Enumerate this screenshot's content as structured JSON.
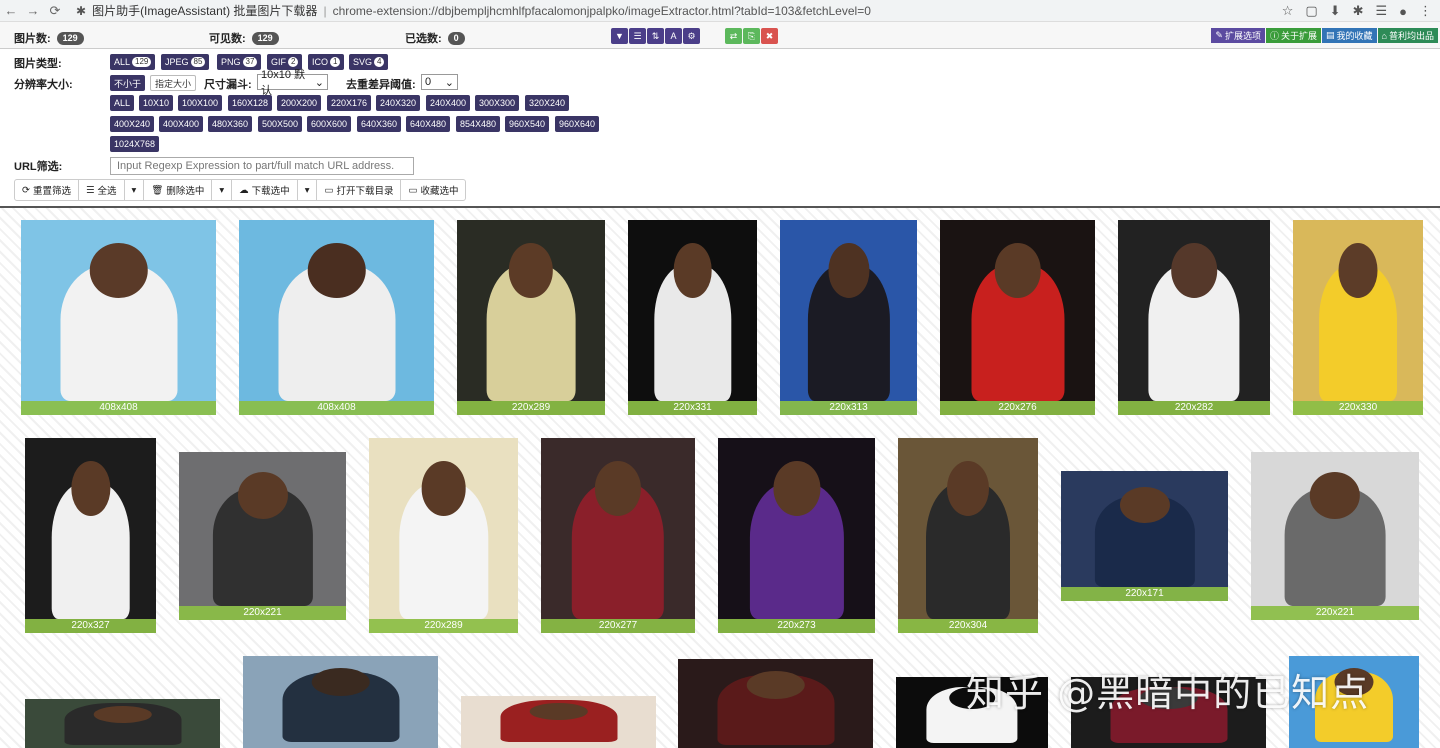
{
  "browser": {
    "back_icon": "←",
    "forward_icon": "→",
    "reload_icon": "⟳",
    "ext_icon": "✱",
    "tab_title": "图片助手(ImageAssistant) 批量图片下载器",
    "separator": "|",
    "url": "chrome-extension://dbjbempljhcmhlfpfacalomonjpalpko/imageExtractor.html?tabId=103&fetchLevel=0",
    "right_icons": [
      "☆",
      "▢",
      "⬇",
      "✱",
      "☰",
      "●",
      "⋮"
    ]
  },
  "stats": {
    "total_label": "图片数:",
    "total_value": "129",
    "visible_label": "可见数:",
    "visible_value": "129",
    "selected_label": "已选数:",
    "selected_value": "0"
  },
  "toolbar_icons": {
    "filter": "▼",
    "list": "☰",
    "sort": "⇅",
    "font": "A",
    "settings": "⚙",
    "swap": "⇄",
    "copy": "⎘",
    "close": "✖"
  },
  "ext_links": {
    "options": "扩展选项",
    "about": "关于扩展",
    "favorites": "我的收藏",
    "home": "普利均出品"
  },
  "filters": {
    "type_label": "图片类型:",
    "types": [
      {
        "name": "ALL",
        "count": "129"
      },
      {
        "name": "JPEG",
        "count": "85"
      },
      {
        "name": "PNG",
        "count": "37"
      },
      {
        "name": "GIF",
        "count": "2"
      },
      {
        "name": "ICO",
        "count": "1"
      },
      {
        "name": "SVG",
        "count": "4"
      }
    ],
    "resolution_label": "分辨率大小:",
    "not_less": "不小于",
    "specify": "指定大小",
    "funnel_label": "尺寸漏斗:",
    "funnel_value": "10x10 默认",
    "dedupe_label": "去重差异阈值:",
    "dedupe_value": "0",
    "sizes_row1": [
      "ALL",
      "10X10",
      "100X100",
      "160X128",
      "200X200",
      "220X176",
      "240X320",
      "240X400",
      "300X300",
      "320X240"
    ],
    "sizes_row2": [
      "400X240",
      "400X400",
      "480X360",
      "500X500",
      "600X600",
      "640X360",
      "640X480",
      "854X480",
      "960X540",
      "960X640"
    ],
    "sizes_row3": [
      "1024X768"
    ],
    "url_label": "URL筛选:",
    "url_placeholder": "Input Regexp Expression to part/full match URL address."
  },
  "actions": {
    "reset": "重置筛选",
    "select_all": "全选",
    "delete": "删除选中",
    "download": "下载选中",
    "open_dir": "打开下载目录",
    "collect": "收藏选中"
  },
  "thumbnails": [
    {
      "size": "408x408",
      "bg": "#7fc4e6",
      "fg": "#f2f2f2",
      "skin": "#5a3a28"
    },
    {
      "size": "408x408",
      "bg": "#6db9e0",
      "fg": "#eeeeee",
      "skin": "#4a2e20"
    },
    {
      "size": "220x289",
      "bg": "#2a2c24",
      "fg": "#d8cf9a",
      "skin": "#5c3b26"
    },
    {
      "size": "220x331",
      "bg": "#0e0e0e",
      "fg": "#e9e9e9",
      "skin": "#5a3a26"
    },
    {
      "size": "220x313",
      "bg": "#2a56a8",
      "fg": "#1b1b24",
      "skin": "#4e3222"
    },
    {
      "size": "220x276",
      "bg": "#1a1312",
      "fg": "#c8201e",
      "skin": "#5a3a26"
    },
    {
      "size": "220x282",
      "bg": "#222222",
      "fg": "#f0f0f0",
      "skin": "#55382a"
    },
    {
      "size": "220x330",
      "bg": "#d9b85a",
      "fg": "#f3cc2a",
      "skin": "#5c3c28"
    },
    {
      "size": "220x327",
      "bg": "#1c1c1c",
      "fg": "#f0f0f0",
      "skin": "#5a3a26"
    },
    {
      "size": "220x221",
      "bg": "#6e6e70",
      "fg": "#303030",
      "skin": "#5a3a26"
    },
    {
      "size": "220x289",
      "bg": "#e9e0c0",
      "fg": "#f4f4f4",
      "skin": "#5a3a26"
    },
    {
      "size": "220x277",
      "bg": "#3a2a2a",
      "fg": "#8a1f2a",
      "skin": "#5a3a26"
    },
    {
      "size": "220x273",
      "bg": "#161018",
      "fg": "#5a2a8a",
      "skin": "#5a3a26"
    },
    {
      "size": "220x304",
      "bg": "#6a5638",
      "fg": "#2a2a2a",
      "skin": "#5a3a26"
    },
    {
      "size": "220x171",
      "bg": "#2a3a5e",
      "fg": "#1a2a4a",
      "skin": "#5a3a26"
    },
    {
      "size": "220x221",
      "bg": "#d8d8d8",
      "fg": "#6a6a6a",
      "skin": "#5a3a26"
    },
    {
      "size": "",
      "bg": "#3a4a3a",
      "fg": "#2a2a2a",
      "skin": "#5a3a26"
    },
    {
      "size": "",
      "bg": "#8aa3b8",
      "fg": "#233040",
      "skin": "#3a2a20"
    },
    {
      "size": "",
      "bg": "#e8ddd0",
      "fg": "#9a2020",
      "skin": "#5a3a26"
    },
    {
      "size": "",
      "bg": "#2a1a1a",
      "fg": "#5a1a1a",
      "skin": "#5a3a26"
    },
    {
      "size": "",
      "bg": "#0c0c0c",
      "fg": "#f4f4f4",
      "skin": "#0c0c0c"
    },
    {
      "size": "",
      "bg": "#1c1c1c",
      "fg": "#7a1a2a",
      "skin": "#3a3a3a"
    },
    {
      "size": "",
      "bg": "#4a9ad8",
      "fg": "#f3cc2a",
      "skin": "#5a3a26"
    }
  ],
  "watermark": "知乎 @黑暗中的已知点"
}
